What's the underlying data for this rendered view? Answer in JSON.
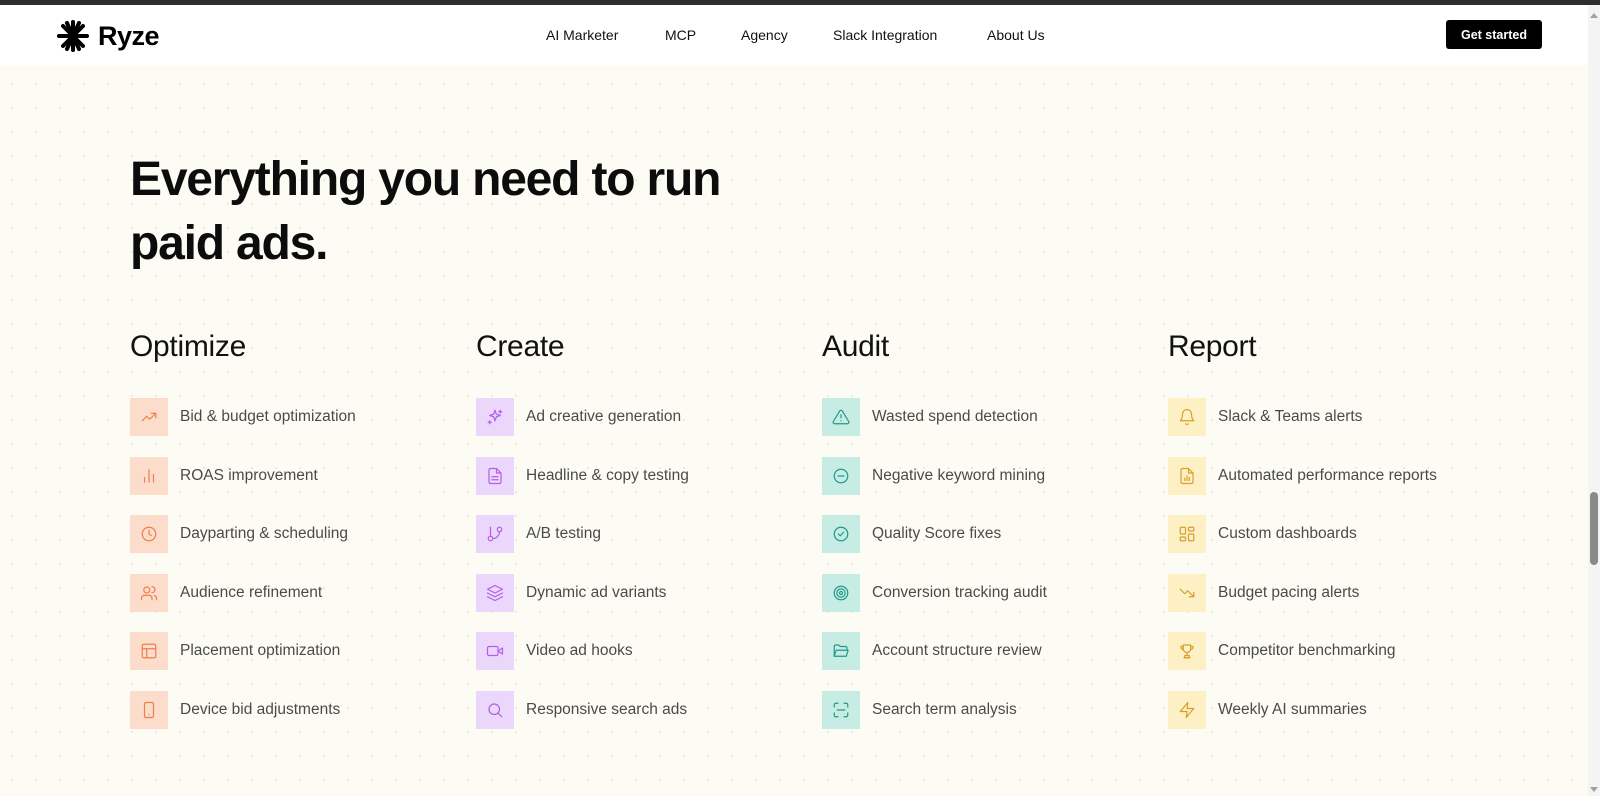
{
  "brand": {
    "name": "Ryze",
    "logo_icon": "asterisk-logo-icon"
  },
  "nav": {
    "links": [
      "AI Marketer",
      "MCP",
      "Agency",
      "Slack Integration",
      "About Us"
    ],
    "cta_label": "Get started"
  },
  "hero": {
    "title_line1": "Everything you need to run",
    "title_line2": "paid ads."
  },
  "colors": {
    "optimize_bg": "#fcdccb",
    "optimize_icon": "#ee7e4a",
    "create_bg": "#ebd7fb",
    "create_icon": "#b25ee6",
    "audit_bg": "#c6ece4",
    "audit_icon": "#22988a",
    "report_bg": "#fdf0c4",
    "report_icon": "#d6a02c"
  },
  "columns": [
    {
      "title": "Optimize",
      "items": [
        {
          "label": "Bid & budget optimization",
          "icon": "trending-up-icon"
        },
        {
          "label": "ROAS improvement",
          "icon": "bar-chart-icon"
        },
        {
          "label": "Dayparting & scheduling",
          "icon": "clock-icon"
        },
        {
          "label": "Audience refinement",
          "icon": "users-icon"
        },
        {
          "label": "Placement optimization",
          "icon": "layout-icon"
        },
        {
          "label": "Device bid adjustments",
          "icon": "tablet-icon"
        }
      ]
    },
    {
      "title": "Create",
      "items": [
        {
          "label": "Ad creative generation",
          "icon": "sparkles-icon"
        },
        {
          "label": "Headline & copy testing",
          "icon": "file-text-icon"
        },
        {
          "label": "A/B testing",
          "icon": "git-branch-icon"
        },
        {
          "label": "Dynamic ad variants",
          "icon": "layers-icon"
        },
        {
          "label": "Video ad hooks",
          "icon": "video-icon"
        },
        {
          "label": "Responsive search ads",
          "icon": "search-icon"
        }
      ]
    },
    {
      "title": "Audit",
      "items": [
        {
          "label": "Wasted spend detection",
          "icon": "alert-triangle-icon"
        },
        {
          "label": "Negative keyword mining",
          "icon": "minus-circle-icon"
        },
        {
          "label": "Quality Score fixes",
          "icon": "check-circle-icon"
        },
        {
          "label": "Conversion tracking audit",
          "icon": "target-icon"
        },
        {
          "label": "Account structure review",
          "icon": "folder-open-icon"
        },
        {
          "label": "Search term analysis",
          "icon": "scan-icon"
        }
      ]
    },
    {
      "title": "Report",
      "items": [
        {
          "label": "Slack & Teams alerts",
          "icon": "bell-icon"
        },
        {
          "label": "Automated performance reports",
          "icon": "file-chart-icon"
        },
        {
          "label": "Custom dashboards",
          "icon": "dashboard-icon"
        },
        {
          "label": "Budget pacing alerts",
          "icon": "trending-down-icon"
        },
        {
          "label": "Competitor benchmarking",
          "icon": "trophy-icon"
        },
        {
          "label": "Weekly AI summaries",
          "icon": "zap-icon"
        }
      ]
    }
  ]
}
